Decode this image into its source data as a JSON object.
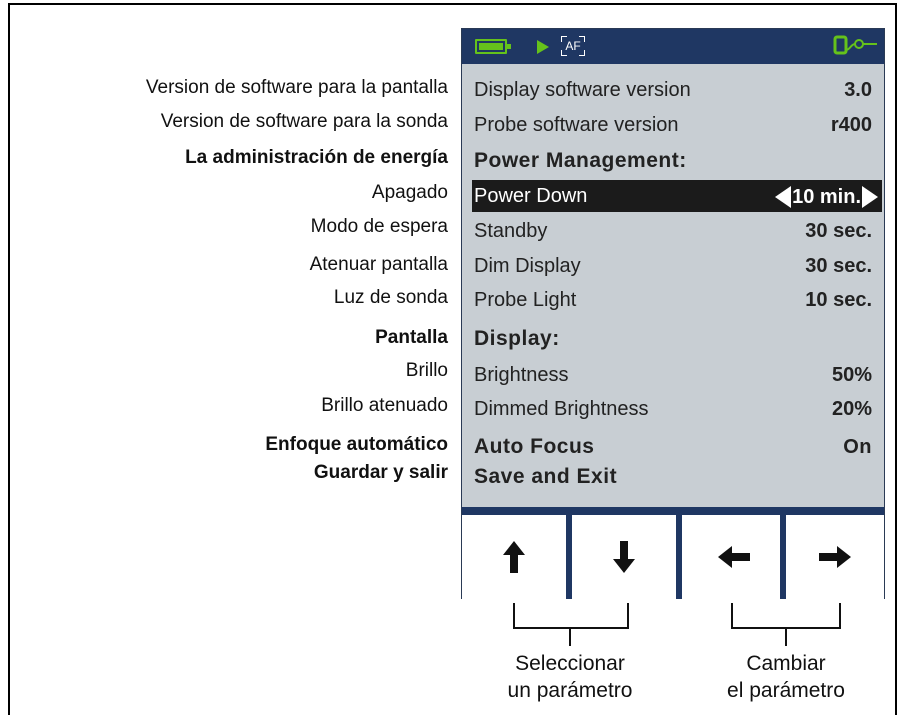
{
  "annotations": {
    "display_sw": "Version de software para la pantalla",
    "probe_sw": "Version de software para la sonda",
    "power_mgmt": "La administración de energía",
    "power_down": "Apagado",
    "standby": "Modo de espera",
    "dim_display": "Atenuar pantalla",
    "probe_light": "Luz de sonda",
    "display": "Pantalla",
    "brightness": "Brillo",
    "dimmed_brightness": "Brillo atenuado",
    "auto_focus": "Enfoque automático",
    "save_exit": "Guardar y salir"
  },
  "status": {
    "af_label": "AF",
    "battery_icon": "battery-full-icon",
    "play_icon": "play-icon",
    "probe_icon": "probe-connected-icon",
    "accent_color": "#65c21b",
    "bar_color": "#1f3763"
  },
  "menu": {
    "display_sw": {
      "label": "Display software version",
      "value": "3.0"
    },
    "probe_sw": {
      "label": "Probe software version",
      "value": "r400"
    },
    "power_header": "Power Management:",
    "power_down": {
      "label": "Power Down",
      "value": "10  min."
    },
    "standby": {
      "label": "Standby",
      "value": "30 sec."
    },
    "dim_display": {
      "label": "Dim Display",
      "value": "30 sec."
    },
    "probe_light": {
      "label": "Probe Light",
      "value": "10 sec."
    },
    "display_header": "Display:",
    "brightness": {
      "label": "Brightness",
      "value": "50%"
    },
    "dimmed_brightness": {
      "label": "Dimmed Brightness",
      "value": "20%"
    },
    "auto_focus": {
      "label": "Auto Focus",
      "value": "On"
    },
    "save_exit": "Save and Exit"
  },
  "buttons": {
    "up_icon": "arrow-up-icon",
    "down_icon": "arrow-down-icon",
    "left_icon": "arrow-left-icon",
    "right_icon": "arrow-right-icon"
  },
  "captions": {
    "select_line1": "Seleccionar",
    "select_line2": "un parámetro",
    "change_line1": "Cambiar",
    "change_line2": "el parámetro"
  }
}
